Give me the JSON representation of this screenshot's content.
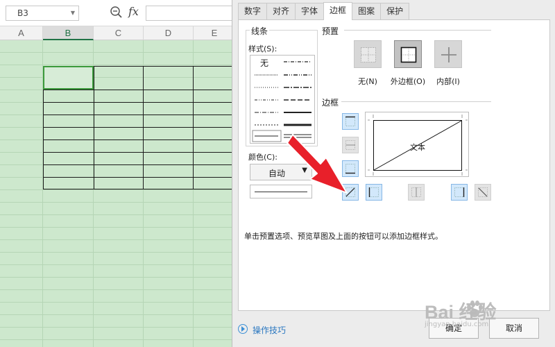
{
  "sheet": {
    "name_box": "B3",
    "fx_label": "fx",
    "columns": [
      "A",
      "B",
      "C",
      "D",
      "E"
    ],
    "active_column": "B"
  },
  "dialog": {
    "tabs": [
      "数字",
      "对齐",
      "字体",
      "边框",
      "图案",
      "保护"
    ],
    "active_tab": "边框",
    "line": {
      "group_title": "线条",
      "style_label": "样式(S):",
      "style_none": "无",
      "color_label": "颜色(C):",
      "color_value": "自动"
    },
    "preset": {
      "group_title": "预置",
      "items": [
        {
          "label": "无(N)",
          "icon": "preset-none-icon"
        },
        {
          "label": "外边框(O)",
          "icon": "preset-outline-icon"
        },
        {
          "label": "内部(I)",
          "icon": "preset-inside-icon"
        }
      ]
    },
    "border": {
      "group_title": "边框",
      "preview_text": "文本",
      "buttons": [
        "border-top",
        "border-middle-horizontal",
        "border-bottom",
        "border-diagonal-up",
        "border-left",
        "border-middle-vertical",
        "border-right",
        "border-diagonal-down"
      ]
    },
    "hint": "单击预置选项、预览草图及上面的按钮可以添加边框样式。",
    "tips_link": "操作技巧",
    "ok_label": "确定",
    "cancel_label": "取消"
  },
  "watermark": {
    "logo": "Bai 经验",
    "url": "jingyan.baidu.com"
  },
  "colors": {
    "sheet_background": "#cde8cd",
    "selection": "#3c9a3c",
    "border_button": "#d2e8fb",
    "arrow": "#e8202a",
    "link": "#2a77c0"
  }
}
